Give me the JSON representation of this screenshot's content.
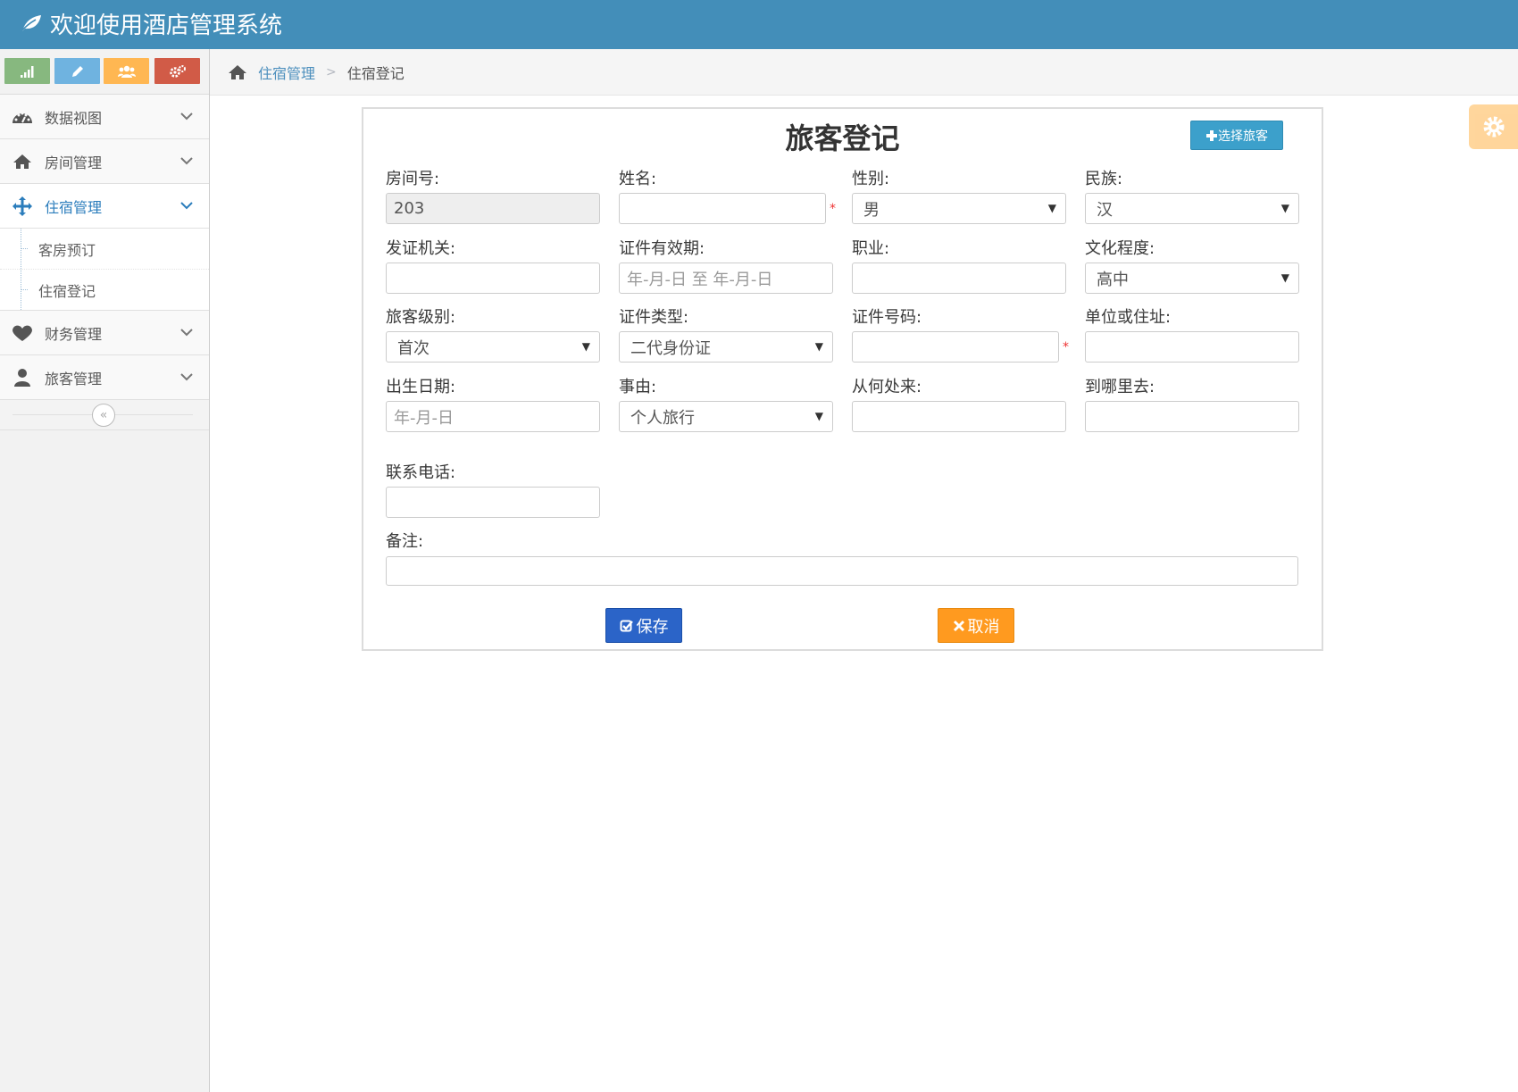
{
  "header": {
    "title": "欢迎使用酒店管理系统"
  },
  "colors": {
    "header_bg": "#438eb9",
    "accent": "#2b7dbc",
    "save_btn": "#2b64c8",
    "cancel_btn": "#ff9a1f",
    "select_btn": "#3ca0cb"
  },
  "sidebar": {
    "shortcuts": [
      "signal-icon",
      "pencil-icon",
      "group-icon",
      "cogs-icon"
    ],
    "items": [
      {
        "label": "数据视图",
        "icon": "dashboard-icon"
      },
      {
        "label": "房间管理",
        "icon": "home-icon"
      },
      {
        "label": "住宿管理",
        "icon": "move-icon",
        "active": true,
        "children": [
          {
            "label": "客房预订"
          },
          {
            "label": "住宿登记"
          }
        ]
      },
      {
        "label": "财务管理",
        "icon": "heart-icon"
      },
      {
        "label": "旅客管理",
        "icon": "user-icon"
      }
    ],
    "collapse_icon": "«"
  },
  "breadcrumb": {
    "parent": "住宿管理",
    "current": "住宿登记",
    "separator": ">"
  },
  "form": {
    "title": "旅客登记",
    "select_guest_label": "选择旅客",
    "fields": {
      "room_no": {
        "label": "房间号:",
        "value": "203"
      },
      "name": {
        "label": "姓名:",
        "value": "",
        "required_mark": "*"
      },
      "gender": {
        "label": "性别:",
        "value": "男"
      },
      "ethnicity": {
        "label": "民族:",
        "value": "汉"
      },
      "issuing_authority": {
        "label": "发证机关:",
        "value": ""
      },
      "id_validity": {
        "label": "证件有效期:",
        "placeholder": "年-月-日 至 年-月-日"
      },
      "occupation": {
        "label": "职业:",
        "value": ""
      },
      "education": {
        "label": "文化程度:",
        "value": "高中"
      },
      "guest_level": {
        "label": "旅客级别:",
        "value": "首次"
      },
      "id_type": {
        "label": "证件类型:",
        "value": "二代身份证"
      },
      "id_number": {
        "label": "证件号码:",
        "value": "",
        "required_mark": "*"
      },
      "address": {
        "label": "单位或住址:",
        "value": ""
      },
      "birth_date": {
        "label": "出生日期:",
        "placeholder": "年-月-日"
      },
      "reason": {
        "label": "事由:",
        "value": "个人旅行"
      },
      "from_where": {
        "label": "从何处来:",
        "value": ""
      },
      "to_where": {
        "label": "到哪里去:",
        "value": ""
      },
      "phone": {
        "label": "联系电话:",
        "value": ""
      },
      "remarks": {
        "label": "备注:",
        "value": ""
      }
    },
    "save_label": "保存",
    "cancel_label": "取消"
  }
}
